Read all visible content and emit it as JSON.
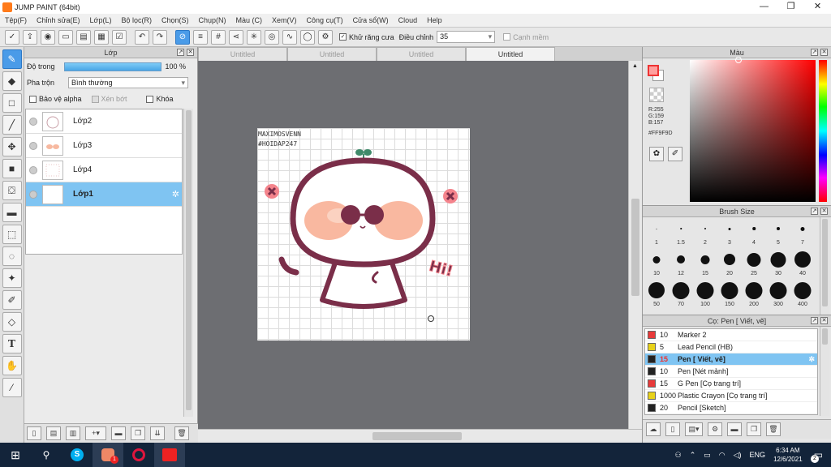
{
  "window": {
    "title": "JUMP PAINT (64bit)",
    "minimize": "—",
    "restore": "❐",
    "close": "✕"
  },
  "menu": [
    "Tệp(F)",
    "Chỉnh sửa(E)",
    "Lớp(L)",
    "Bộ lọc(R)",
    "Chọn(S)",
    "Chụp(N)",
    "Màu (C)",
    "Xem(V)",
    "Công cụ(T)",
    "Cửa sổ(W)",
    "Cloud",
    "Help"
  ],
  "toolbar": {
    "antialias_label": "Khử răng cưa",
    "adjust_label": "Điều chỉnh",
    "adjust_value": "35",
    "edge_label": "Cạnh mềm"
  },
  "layers_panel": {
    "title": "Lớp",
    "opacity_label": "Độ trong",
    "opacity_value": "100 %",
    "blend_label": "Pha trộn",
    "blend_value": "Bình thường",
    "protect_alpha": "Bảo vệ alpha",
    "clip": "Xén bớt",
    "lock": "Khóa",
    "layers": [
      {
        "name": "Lớp2",
        "selected": false
      },
      {
        "name": "Lớp3",
        "selected": false
      },
      {
        "name": "Lớp4",
        "selected": false
      },
      {
        "name": "Lớp1",
        "selected": true
      }
    ]
  },
  "tabs": [
    "Untitled",
    "Untitled",
    "Untitled",
    "Untitled"
  ],
  "active_tab": 3,
  "canvas": {
    "watermark_line1": "MAXIMOSVENN",
    "watermark_line2": "#HOIDAP247",
    "hi_text": "Hi!"
  },
  "color_panel": {
    "title": "Màu",
    "r": "R:255",
    "g": "G:159",
    "b": "B:157",
    "hex": "#FF9F9D",
    "fg_color": "#FF9F9D"
  },
  "brush_size": {
    "title": "Brush Size",
    "sizes": [
      "1",
      "1.5",
      "2",
      "3",
      "4",
      "5",
      "7",
      "10",
      "12",
      "15",
      "20",
      "25",
      "30",
      "40",
      "50",
      "70",
      "100",
      "150",
      "200",
      "300",
      "400"
    ]
  },
  "brush_list": {
    "title": "Cọ: Pen [ Viết, vẽ]",
    "items": [
      {
        "size": "10",
        "name": "Marker 2",
        "color": "#e83a3a",
        "selected": false
      },
      {
        "size": "5",
        "name": "Lead Pencil (HB)",
        "color": "#e8d21a",
        "selected": false
      },
      {
        "size": "15",
        "name": "Pen [ Viết, vẽ]",
        "color": "#222222",
        "selected": true
      },
      {
        "size": "10",
        "name": "Pen [Nét mảnh]",
        "color": "#222222",
        "selected": false
      },
      {
        "size": "15",
        "name": "G Pen [Cọ trang trí]",
        "color": "#e83a3a",
        "selected": false
      },
      {
        "size": "1000",
        "name": "Plastic Crayon [Cọ trang trí]",
        "color": "#e8d21a",
        "selected": false
      },
      {
        "size": "20",
        "name": "Pencil [Sketch]",
        "color": "#222222",
        "selected": false
      }
    ]
  },
  "taskbar": {
    "lang": "ENG",
    "time": "6:34 AM",
    "date": "12/6/2021",
    "notify_count": "2",
    "app_badge": "1"
  }
}
